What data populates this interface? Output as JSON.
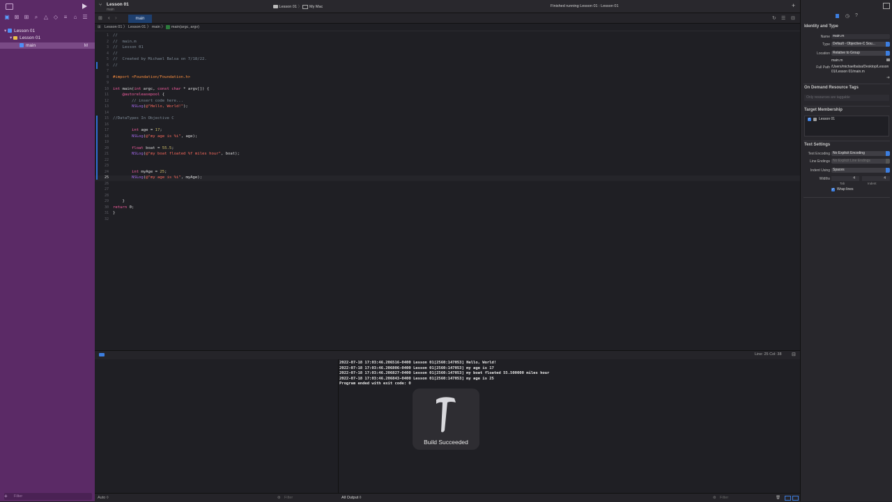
{
  "window": {
    "project_title": "Lesson 01",
    "branch": "main",
    "scheme": "Lesson 01",
    "destination": "My Mac",
    "status": "Finished running Lesson 01 : Lesson 01"
  },
  "navigator": {
    "items": [
      {
        "label": "Lesson 01",
        "kind": "project"
      },
      {
        "label": "Lesson 01",
        "kind": "folder"
      },
      {
        "label": "main",
        "kind": "file",
        "badge": "M"
      }
    ],
    "filter_placeholder": "Filter"
  },
  "tabs": [
    {
      "label": "main"
    }
  ],
  "jumpbar": {
    "crumbs": [
      "Lesson 01",
      "Lesson 01",
      "main",
      "main(argc, argv)"
    ]
  },
  "editor": {
    "current_line": 25,
    "lines": [
      {
        "n": "1",
        "t": "//",
        "k": "com"
      },
      {
        "n": "2",
        "t": "//  main.m",
        "k": "com"
      },
      {
        "n": "3",
        "t": "//  Lesson 01",
        "k": "com"
      },
      {
        "n": "4",
        "t": "//",
        "k": "com"
      },
      {
        "n": "5",
        "t": "//  Created by Michael Balsa on 7/18/22.",
        "k": "com"
      },
      {
        "n": "6",
        "t": "//",
        "k": "com"
      },
      {
        "n": "7",
        "t": "",
        "k": ""
      },
      {
        "n": "8",
        "t": "#import <Foundation/Foundation.h>",
        "k": "pre"
      },
      {
        "n": "9",
        "t": "",
        "k": ""
      },
      {
        "n": "10",
        "t": "int main(int argc, const char * argv[]) {",
        "k": "code"
      },
      {
        "n": "11",
        "t": "    @autoreleasepool {",
        "k": "code"
      },
      {
        "n": "12",
        "t": "        // insert code here...",
        "k": "com"
      },
      {
        "n": "13",
        "t": "        NSLog(@\"Hello, World!\");",
        "k": "code"
      },
      {
        "n": "14",
        "t": "",
        "k": ""
      },
      {
        "n": "15",
        "t": "//DataTypes In Objective C",
        "k": "com"
      },
      {
        "n": "16",
        "t": "",
        "k": ""
      },
      {
        "n": "17",
        "t": "        int age = 17;",
        "k": "code"
      },
      {
        "n": "18",
        "t": "        NSLog(@\"my age is %i\", age);",
        "k": "code"
      },
      {
        "n": "19",
        "t": "",
        "k": ""
      },
      {
        "n": "20",
        "t": "        float boat = 55.5;",
        "k": "code"
      },
      {
        "n": "21",
        "t": "        NSLog(@\"my boat floated %f miles hour\", boat);",
        "k": "code"
      },
      {
        "n": "22",
        "t": "",
        "k": ""
      },
      {
        "n": "23",
        "t": "",
        "k": ""
      },
      {
        "n": "24",
        "t": "        int myAge = 25;",
        "k": "code"
      },
      {
        "n": "25",
        "t": "        NSLog(@\"my age is %i\", myAge);",
        "k": "code"
      },
      {
        "n": "26",
        "t": "",
        "k": ""
      },
      {
        "n": "27",
        "t": "",
        "k": ""
      },
      {
        "n": "28",
        "t": "",
        "k": ""
      },
      {
        "n": "29",
        "t": "    }",
        "k": "code"
      },
      {
        "n": "30",
        "t": "return 0;",
        "k": "code"
      },
      {
        "n": "31",
        "t": "}",
        "k": "code"
      },
      {
        "n": "32",
        "t": "",
        "k": ""
      }
    ],
    "line_col": "Line: 25  Col: 38"
  },
  "console": {
    "lines": [
      "2022-07-18 17:03:46.206516-0400 Lesson 01[2560:147053] Hello, World!",
      "2022-07-18 17:03:46.206806-0400 Lesson 01[2560:147053] my age is 17",
      "2022-07-18 17:03:46.206827-0400 Lesson 01[2560:147053] my boat floated 55.500000 miles hour",
      "2022-07-18 17:03:46.206843-0400 Lesson 01[2560:147053] my age is 25",
      "Program ended with exit code: 0"
    ],
    "output_selector": "All Output ◊",
    "auto_selector": "Auto ◊",
    "filter_placeholder": "Filter"
  },
  "hud": {
    "label": "Build Succeeded",
    "icon": "hammer-icon"
  },
  "inspector": {
    "identity_title": "Identity and Type",
    "name_label": "Name",
    "name_value": "main.m",
    "type_label": "Type",
    "type_value": "Default - Objective-C Sou...",
    "location_label": "Location",
    "location_value": "Relative to Group",
    "location_file": "main.m",
    "fullpath_label": "Full Path",
    "fullpath_value": "/Users/michaelbalsa/Desktop/Lesson 01/Lesson 01/main.m",
    "odr_title": "On Demand Resource Tags",
    "odr_placeholder": "Only resources are taggable",
    "target_title": "Target Membership",
    "target_item": "Lesson 01",
    "text_title": "Text Settings",
    "encoding_label": "Text Encoding",
    "encoding_value": "No Explicit Encoding",
    "endings_label": "Line Endings",
    "endings_value": "No Explicit Line Endings",
    "indent_label": "Indent Using",
    "indent_value": "Spaces",
    "widths_label": "Widths",
    "tab_value": "4",
    "indent_width_value": "4",
    "tab_caption": "Tab",
    "indent_caption": "Indent",
    "wrap_label": "Wrap lines"
  },
  "colors": {
    "sidebar": "#5b2a66",
    "accent": "#3c7ee0",
    "editor_bg": "#1f1f24"
  }
}
